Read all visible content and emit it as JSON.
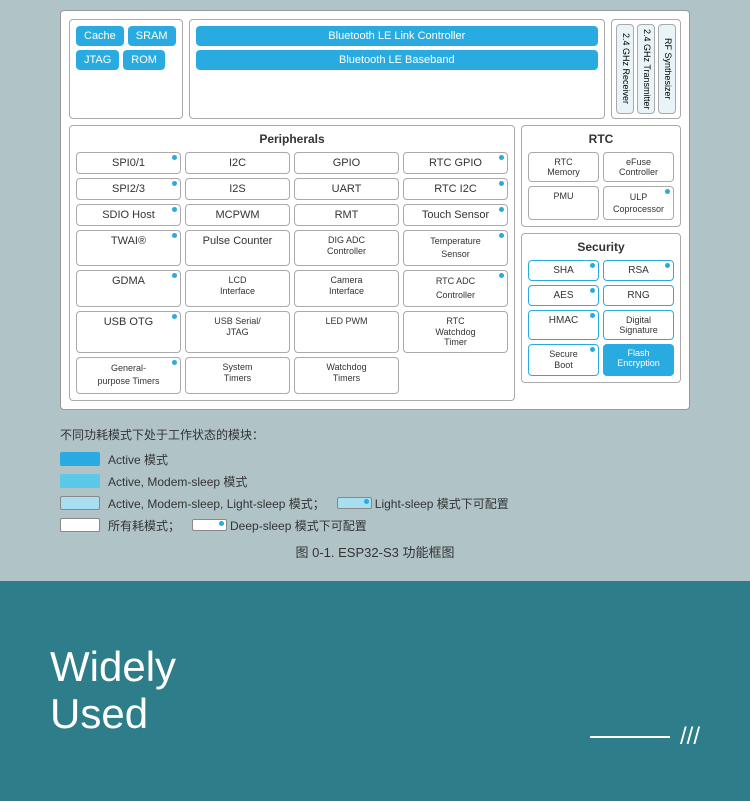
{
  "diagram": {
    "cpu": {
      "row1": [
        "Cache",
        "SRAM"
      ],
      "row2": [
        "JTAG",
        "ROM"
      ]
    },
    "ble": {
      "items": [
        "Bluetooth LE Link Controller",
        "Bluetooth LE Baseband"
      ]
    },
    "rf": {
      "items": [
        "2.4 GHz Receiver",
        "2.4 GHz Transmitter",
        "RF Synthesizer"
      ]
    },
    "peripherals": {
      "title": "Peripherals",
      "items": [
        {
          "label": "SPI0/1",
          "dot": true
        },
        {
          "label": "I2C",
          "dot": false
        },
        {
          "label": "GPIO",
          "dot": false
        },
        {
          "label": "RTC GPIO",
          "dot": true
        },
        {
          "label": "SPI2/3",
          "dot": true
        },
        {
          "label": "I2S",
          "dot": false
        },
        {
          "label": "UART",
          "dot": false
        },
        {
          "label": "RTC I2C",
          "dot": true
        },
        {
          "label": "SDIO Host",
          "dot": true
        },
        {
          "label": "MCPWM",
          "dot": false
        },
        {
          "label": "RMT",
          "dot": false
        },
        {
          "label": "Touch Sensor",
          "dot": true
        },
        {
          "label": "TWAI®",
          "dot": true
        },
        {
          "label": "Pulse Counter",
          "dot": false
        },
        {
          "label": "DIG ADC Controller",
          "dot": false
        },
        {
          "label": "Temperature Sensor",
          "dot": true
        },
        {
          "label": "GDMA",
          "dot": true
        },
        {
          "label": "LCD Interface",
          "dot": false
        },
        {
          "label": "Camera Interface",
          "dot": false
        },
        {
          "label": "RTC ADC Controller",
          "dot": true
        },
        {
          "label": "USB OTG",
          "dot": true
        },
        {
          "label": "USB Serial/ JTAG",
          "dot": false
        },
        {
          "label": "LED PWM",
          "dot": false
        },
        {
          "label": "RTC Watchdog Timer",
          "dot": false
        },
        {
          "label": "General-purpose Timers",
          "dot": true
        },
        {
          "label": "System Timers",
          "dot": false
        },
        {
          "label": "Watchdog Timers",
          "dot": false
        },
        {
          "label": "",
          "dot": false
        }
      ]
    },
    "rtc": {
      "title": "RTC",
      "items": [
        {
          "label": "RTC Memory",
          "dot": false
        },
        {
          "label": "eFuse Controller",
          "dot": false
        },
        {
          "label": "PMU",
          "dot": false
        },
        {
          "label": "ULP Coprocessor",
          "dot": true
        }
      ]
    },
    "security": {
      "title": "Security",
      "items": [
        {
          "label": "SHA",
          "dot": true
        },
        {
          "label": "RSA",
          "dot": true
        },
        {
          "label": "AES",
          "dot": true
        },
        {
          "label": "RNG",
          "dot": false
        },
        {
          "label": "HMAC",
          "dot": true
        },
        {
          "label": "Digital Signature",
          "dot": true
        },
        {
          "label": "Secure Boot",
          "dot": true
        },
        {
          "label": "Flash Encryption",
          "solid": true
        }
      ]
    }
  },
  "legend": {
    "title": "不同功耗模式下处于工作状态的模块：",
    "items": [
      {
        "label": "Active 模式",
        "type": "dark"
      },
      {
        "label": "Active, Modem-sleep 模式",
        "type": "medium"
      },
      {
        "label": "Active, Modem-sleep, Light-sleep 模式；",
        "type": "light",
        "extra": "Light-sleep 模式下可配置"
      },
      {
        "label": "所有耗模式；",
        "type": "outline",
        "extra": "Deep-sleep 模式下可配置"
      }
    ]
  },
  "figure_caption": "图 0-1. ESP32-S3 功能框图",
  "bottom": {
    "text_line1": "Widely",
    "text_line2": "Used",
    "decoration": "///"
  }
}
